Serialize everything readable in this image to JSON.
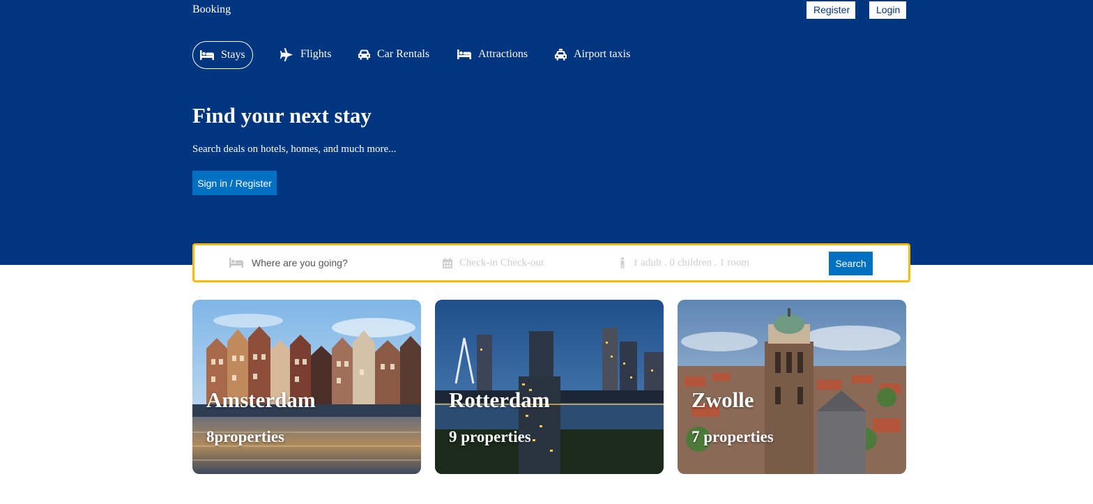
{
  "header": {
    "brand": "Booking",
    "register_label": "Register",
    "login_label": "Login"
  },
  "nav": {
    "items": [
      {
        "label": "Stays",
        "icon": "bed-icon",
        "active": true
      },
      {
        "label": "Flights",
        "icon": "plane-icon"
      },
      {
        "label": "Car Rentals",
        "icon": "car-icon"
      },
      {
        "label": "Attractions",
        "icon": "bed-icon"
      },
      {
        "label": "Airport taxis",
        "icon": "taxi-icon"
      }
    ]
  },
  "hero": {
    "title": "Find your next stay",
    "subtitle": "Search deals on hotels, homes, and much more...",
    "cta_label": "Sign in / Register"
  },
  "search": {
    "destination_placeholder": "Where are you going?",
    "dates_label": "Check-in Check-out",
    "guests_label": "1 adult . 0 children . 1 room",
    "button_label": "Search"
  },
  "featured": [
    {
      "city": "Amsterdam",
      "properties": "8properties"
    },
    {
      "city": "Rotterdam",
      "properties": "9 properties"
    },
    {
      "city": "Zwolle",
      "properties": "7 properties"
    }
  ],
  "colors": {
    "primary": "#003580",
    "accent": "#0071c2",
    "search_border": "#febb02"
  }
}
